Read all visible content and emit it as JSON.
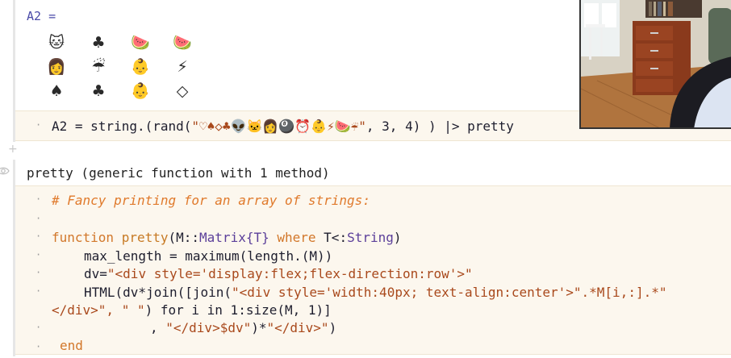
{
  "cell1": {
    "output_label": "A2 =",
    "grid": [
      [
        "🐱",
        "♣",
        "🍉",
        "🍉"
      ],
      [
        "👩",
        "☔",
        "👶",
        "⚡"
      ],
      [
        "♠",
        "♣",
        "👶",
        "◇"
      ]
    ],
    "code_pre": "A2 = string.(rand(",
    "code_str": "\"♡♠◇♣👽🐱👩🎱⏰👶⚡🍉☔\"",
    "code_post": ", 3, 4) ) |> pretty"
  },
  "cell2": {
    "output_text": "pretty (generic function with 1 method)",
    "comment": "# Fancy printing for an array of strings:",
    "l_function_kw": "function",
    "l_function_name": "pretty",
    "l_function_sig1": "(M::",
    "l_function_type": "Matrix{T}",
    "l_function_where": " where ",
    "l_function_T": "T<:",
    "l_function_string": "String",
    "l_function_close": ")",
    "l_maxlen": "max_length = maximum(length.(M))",
    "l_dv_pre": "dv=",
    "l_dv_str": "\"<div style='display:flex;flex-direction:row'>\"",
    "l_html_pre": "HTML(dv*join([join(",
    "l_html_str1": "\"<div style='width:40px; text-align:center'>\"",
    "l_html_mid": ".*M[i,:].*\"",
    "l_wrap_str": "</div>\", \" \"",
    "l_wrap_post": ") for i in 1:size(M, 1)]",
    "l_tail_pre": ", ",
    "l_tail_str": "\"</div>$dv\"",
    "l_tail_mid": ")*",
    "l_tail_str2": "\"</div>\"",
    "l_tail_close": ")",
    "l_end": "end"
  },
  "ui": {
    "add_cell_glyph": "+",
    "eye_icon": "eye-icon"
  },
  "colors": {
    "code_bg": "#fcf7ee",
    "keyword": "#d2772a",
    "string": "#a9491c",
    "comment": "#e07a2c",
    "output_label": "#4a4aa8"
  }
}
